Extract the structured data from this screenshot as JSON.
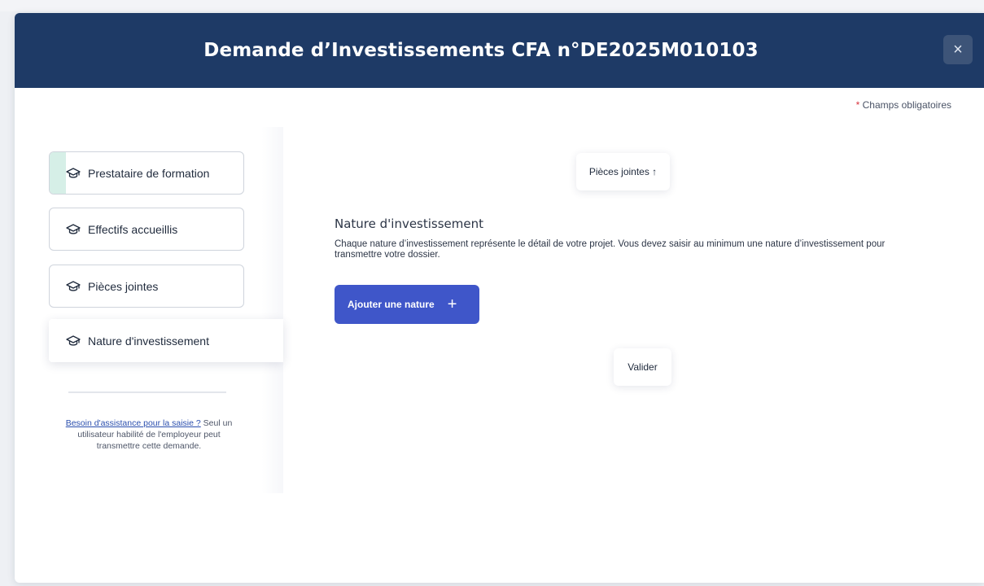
{
  "modal": {
    "title": "Demande d’Investissements CFA n°DE2025M010103",
    "close_label": "×",
    "required_star": "*",
    "required_text": "Champs obligatoires"
  },
  "sidebar": {
    "steps": [
      {
        "label": "Prestataire de formation",
        "icon": "graduation-cap-icon"
      },
      {
        "label": "Effectifs accueillis",
        "icon": "graduation-cap-icon"
      },
      {
        "label": "Pièces jointes",
        "icon": "graduation-cap-icon"
      },
      {
        "label": "Nature d'investissement",
        "icon": "graduation-cap-icon"
      }
    ],
    "help_link": "Besoin d'assistance pour la saisie ?",
    "help_text": " Seul un utilisateur habilité de l'employeur peut transmettre cette demande."
  },
  "content": {
    "prev_button": "Pièces jointes ↑",
    "section_title": "Nature d'investissement",
    "section_description": "Chaque nature d’investissement représente le détail de votre projet. Vous devez saisir au minimum une nature d’investissement pour transmettre votre dossier.",
    "add_button": "Ajouter une nature",
    "add_icon": "+",
    "validate_button": "Valider"
  },
  "colors": {
    "header": "#1e3a66",
    "primary": "#3f56c9",
    "required": "#d8343f",
    "progress": "#d6efe7"
  }
}
